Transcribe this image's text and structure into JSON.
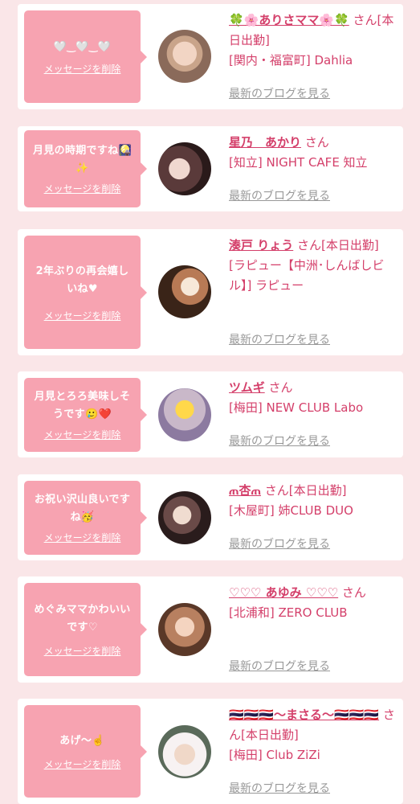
{
  "delete_label": "メッセージを削除",
  "blog_label": "最新のブログを見る",
  "cards": [
    {
      "message": "🤍‿🤍‿🤍",
      "name": "🍀🌸ありさママ🌸🍀",
      "san": "さん",
      "status": "[本日出勤]",
      "shop": "[関内・福富町] Dahlia"
    },
    {
      "message": "月見の時期ですね🎑✨",
      "name": "星乃　あかり",
      "san": "さん",
      "status": "",
      "shop": "[知立] NIGHT CAFE 知立"
    },
    {
      "message": "2年ぶりの再会嬉しいね♥",
      "name": "湊戸 りょう",
      "san": "さん",
      "status": "[本日出勤]",
      "shop": "[ラピュー【中洲･しんばしビル】] ラピュー"
    },
    {
      "message": "月見とろろ美味しそうです🥲❤️",
      "name": "ツムギ",
      "san": "さん",
      "status": "",
      "shop": "[梅田] NEW CLUB Labo"
    },
    {
      "message": "お祝い沢山良いですね🥳",
      "name": "ጠ杏ጠ",
      "san": "さん",
      "status": "[本日出勤]",
      "shop": "[木屋町] 姉CLUB DUO"
    },
    {
      "message": "めぐみママかわいいです♡",
      "name": "♡♡♡ あゆみ ♡♡♡",
      "san": "さん",
      "status": "",
      "shop": "[北浦和] ZERO CLUB"
    },
    {
      "message": "あげ〜☝️",
      "name": "🇹🇭🇹🇭🇹🇭〜まさる〜🇹🇭🇹🇭🇹🇭",
      "san": "さん",
      "status": "[本日出勤]",
      "shop": "[梅田] Club ZiZi"
    }
  ]
}
